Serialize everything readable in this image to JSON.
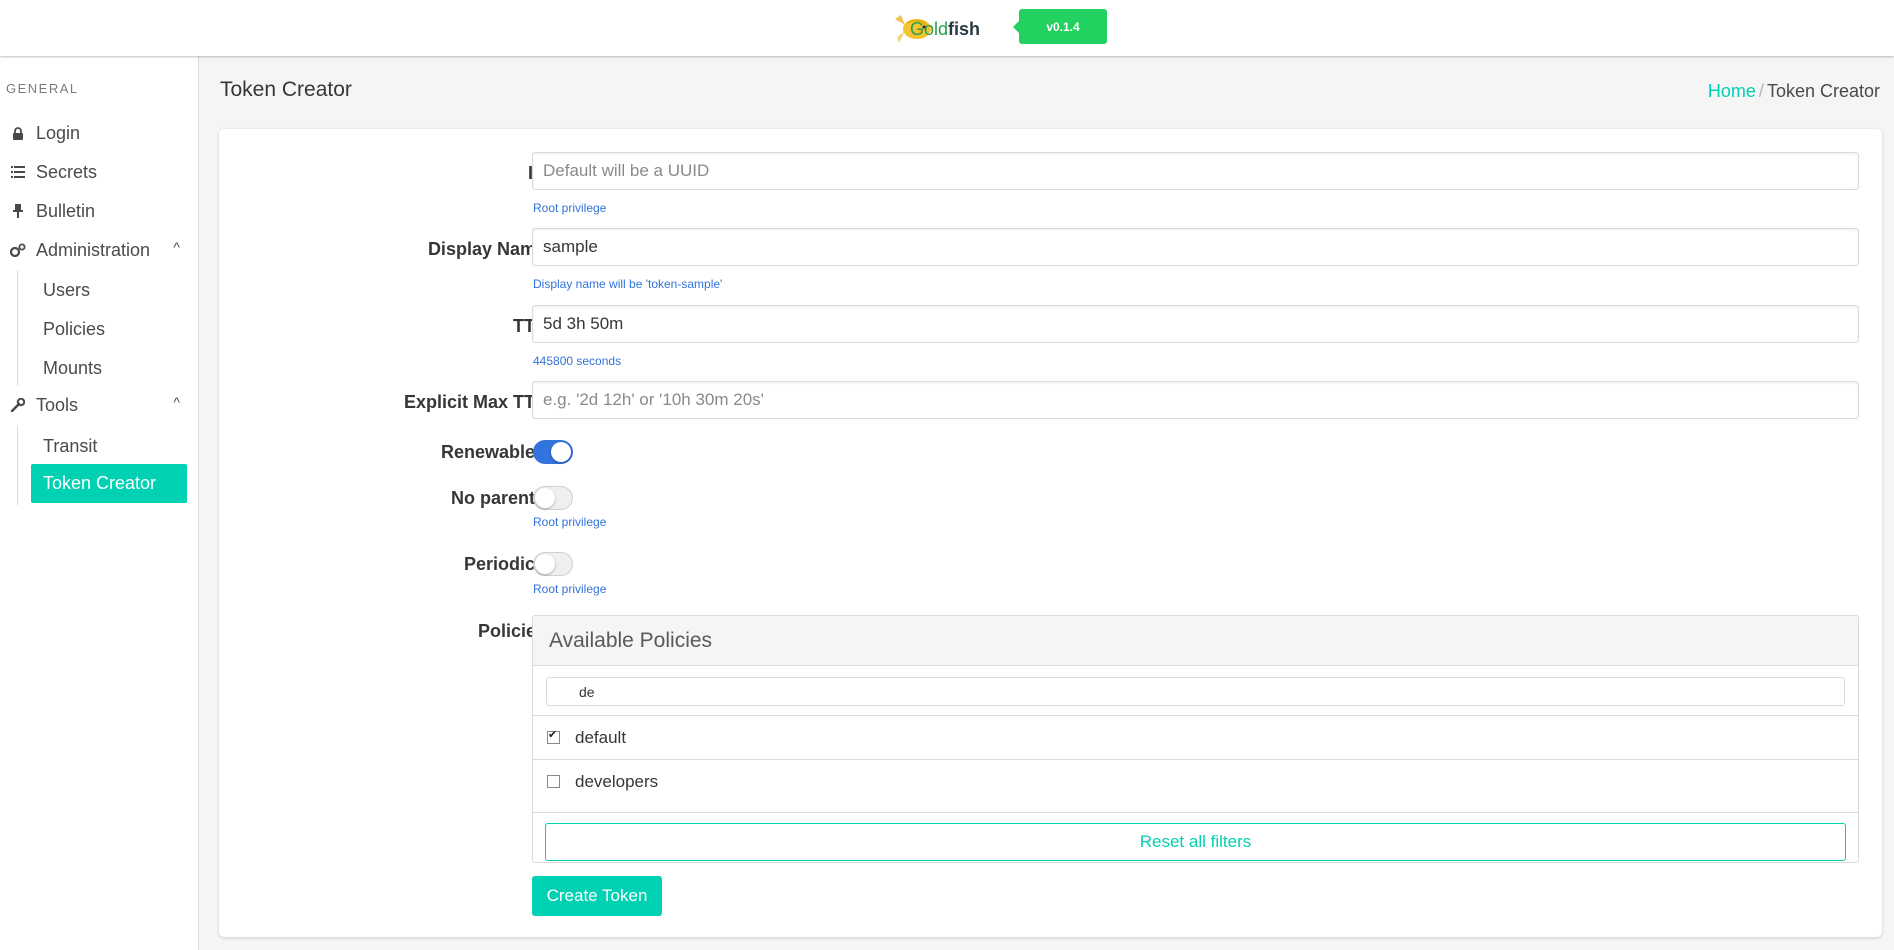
{
  "header": {
    "brand_gold": "Gold",
    "brand_fish": "fish",
    "version": "v0.1.4"
  },
  "sidebar": {
    "section_label": "GENERAL",
    "items": [
      {
        "label": "Login",
        "icon": "lock-icon"
      },
      {
        "label": "Secrets",
        "icon": "list-icon"
      },
      {
        "label": "Bulletin",
        "icon": "pin-icon"
      },
      {
        "label": "Administration",
        "icon": "cogs-icon"
      },
      {
        "label": "Tools",
        "icon": "wrench-icon"
      }
    ],
    "admin_sub": [
      "Users",
      "Policies",
      "Mounts"
    ],
    "tools_sub": [
      "Transit",
      "Token Creator"
    ],
    "active": "Token Creator"
  },
  "page": {
    "title": "Token Creator",
    "breadcrumb": {
      "home": "Home",
      "sep": "/",
      "current": "Token Creator"
    }
  },
  "form": {
    "id": {
      "label": "ID",
      "placeholder": "Default will be a UUID",
      "value": "",
      "help": "Root privilege"
    },
    "display_name": {
      "label": "Display Name",
      "value": "sample",
      "help": "Display name will be 'token-sample'"
    },
    "ttl": {
      "label": "TTL",
      "value": "5d 3h 50m",
      "help": "445800 seconds"
    },
    "max_ttl": {
      "label": "Explicit Max TTL",
      "placeholder": "e.g. '2d 12h' or '10h 30m 20s'",
      "value": ""
    },
    "renewable": {
      "label": "Renewable?",
      "on": true
    },
    "no_parent": {
      "label": "No parent?",
      "on": false,
      "help": "Root privilege"
    },
    "periodic": {
      "label": "Periodic?",
      "on": false,
      "help": "Root privilege"
    },
    "policies": {
      "label": "Policies",
      "heading": "Available Policies",
      "search_value": "de",
      "items": [
        {
          "name": "default",
          "checked": true
        },
        {
          "name": "developers",
          "checked": false
        }
      ],
      "reset_label": "Reset all filters"
    },
    "submit_label": "Create Token"
  },
  "colors": {
    "primary": "#00d1b2",
    "link": "#3273dc",
    "version_badge": "#23d160"
  }
}
